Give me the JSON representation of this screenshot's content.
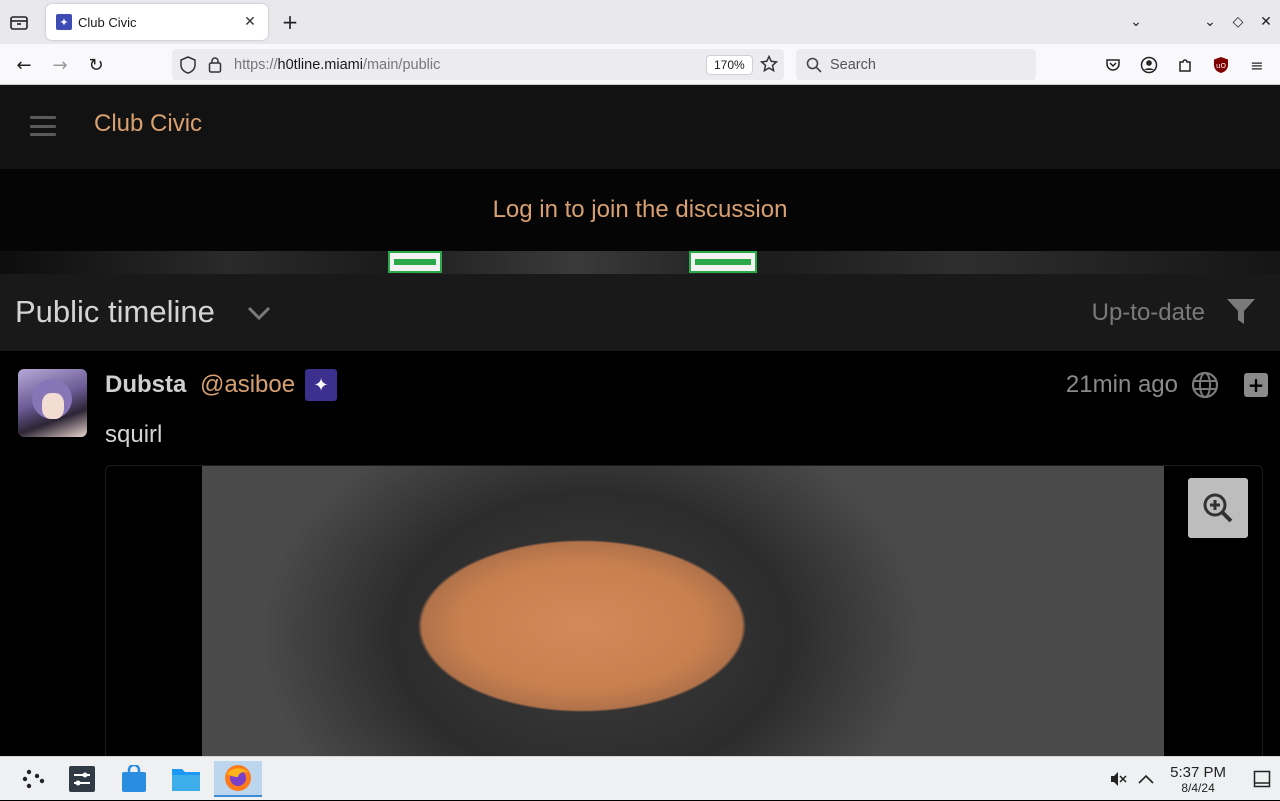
{
  "browser": {
    "tab_title": "Club Civic",
    "url_prefix": "https://",
    "url_domain": "h0tline.miami",
    "url_path": "/main/public",
    "zoom_level": "170%",
    "search_placeholder": "Search"
  },
  "site": {
    "title": "Club Civic",
    "login_prompt": "Log in to join the discussion",
    "accent_color": "#d8a070"
  },
  "timeline": {
    "title": "Public timeline",
    "status": "Up-to-date"
  },
  "post": {
    "author_name": "Dubsta",
    "author_handle": "@asiboe",
    "time": "21min ago",
    "text": "squirl"
  },
  "taskbar": {
    "time": "5:37 PM",
    "date": "8/4/24"
  }
}
